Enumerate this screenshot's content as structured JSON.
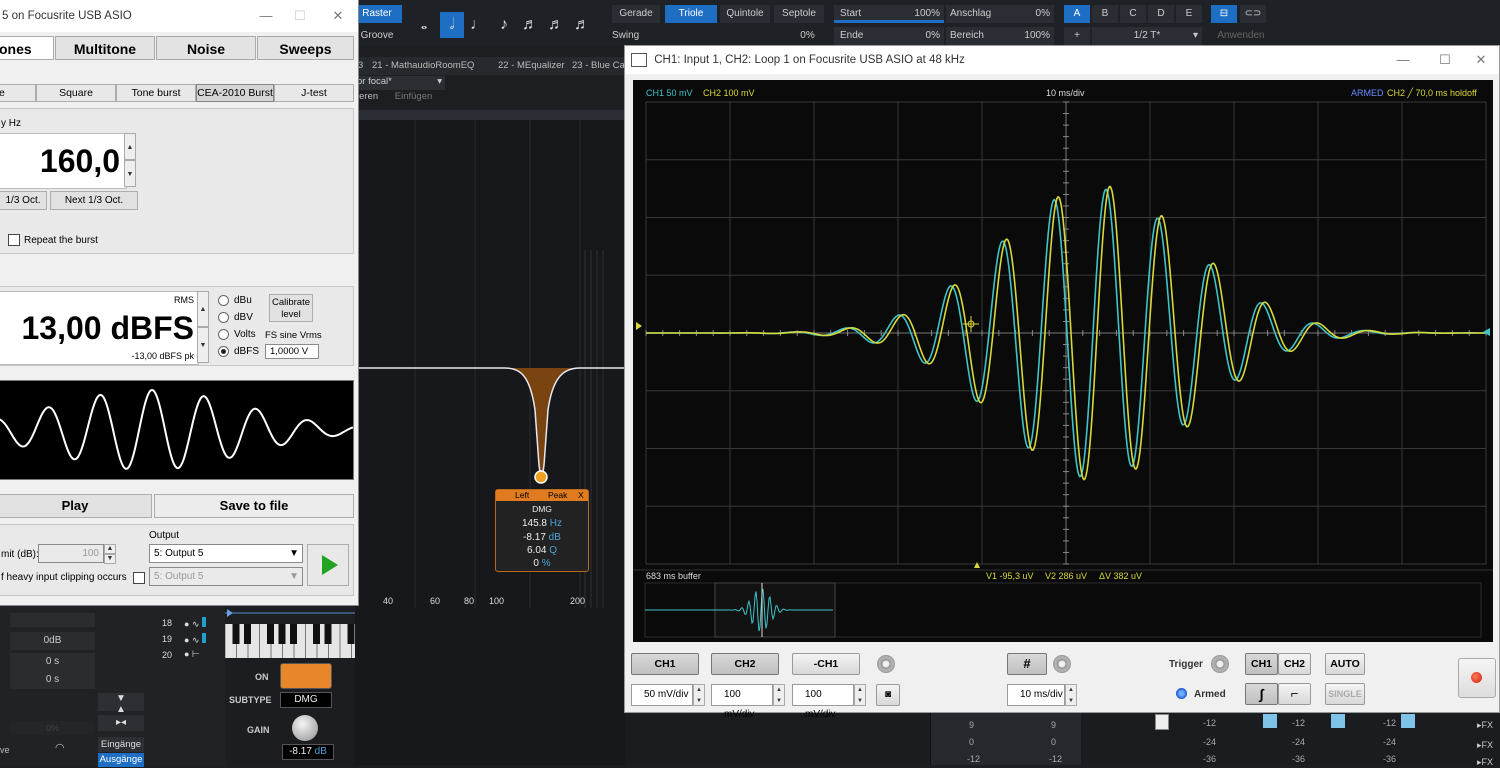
{
  "daw": {
    "raster_label": "Raster",
    "groove_label": "Groove",
    "quant_tabs": [
      "Gerade",
      "Triole",
      "Quintole",
      "Septole"
    ],
    "quant_active": "Triole",
    "swing_label": "Swing",
    "swing_value": "0%",
    "start_label": "Start",
    "start_value": "100%",
    "ende_label": "Ende",
    "ende_value": "0%",
    "anschlag_label": "Anschlag",
    "anschlag_value": "0%",
    "bereich_label": "Bereich",
    "bereich_value": "100%",
    "letters": [
      "A",
      "B",
      "C",
      "D",
      "E"
    ],
    "letter_active": "A",
    "half_label": "1/2 T*",
    "plus_label": "+",
    "anwenden_label": "Anwenden",
    "plugin_tabs": [
      "3",
      "21 - MathaudioRoomEQ",
      "22 - MEqualizer",
      "23 - Blue Ca"
    ],
    "preset_label": "or focal*",
    "menu_items": [
      "ieren",
      "Einfügen"
    ],
    "eq_freq_labels": [
      "40",
      "60",
      "80",
      "100",
      "200"
    ],
    "eq_popup": {
      "head_left": "Left",
      "head_mid": "Peak",
      "head_x": "X",
      "type": "DMG",
      "freq": "145.8",
      "freq_unit": "Hz",
      "gain": "-8.17",
      "gain_unit": "dB",
      "q": "6.04",
      "q_unit": "Q",
      "mix": "0",
      "mix_unit": "%"
    },
    "track_numbers": [
      "18",
      "19",
      "20"
    ],
    "bottom_values": [
      "0dB",
      "0 s",
      "0 s",
      "0%"
    ],
    "eingaenge_label": "Eingänge",
    "ausgaenge_label": "Ausgänge",
    "ve_label": "ve",
    "on_label": "ON",
    "subtype_label": "SUBTYPE",
    "subtype_value": "DMG",
    "gain_label": "GAIN",
    "gain_value": "-8.17",
    "gain_unit": "dB",
    "mixer_values": [
      "9",
      "0",
      "-12",
      "9",
      "0",
      "-12",
      "-12",
      "-24",
      "-36",
      "-12",
      "-24",
      "-36",
      "-12",
      "-24",
      "-36"
    ],
    "fx_label": "FX"
  },
  "generator": {
    "title": "5 on Focusrite USB ASIO",
    "tabs": [
      "ones",
      "Multitone",
      "Noise",
      "Sweeps"
    ],
    "active_tab": "ones",
    "subtabs": [
      "e",
      "Square",
      "Tone burst",
      "CEA-2010 Burst",
      "J-test"
    ],
    "active_subtab": "CEA-2010 Burst",
    "freq_label": "y Hz",
    "freq_value": "160,0",
    "prev_oct": "1/3 Oct.",
    "next_oct": "Next 1/3 Oct.",
    "repeat_label": "Repeat the burst",
    "level_mode": "RMS",
    "level_value": "13,00 dBFS",
    "level_pk": "-13,00 dBFS pk",
    "units": [
      "dBu",
      "dBV",
      "Volts",
      "dBFS"
    ],
    "unit_selected": "dBFS",
    "calibrate_label": "Calibrate level",
    "fs_label": "FS sine Vrms",
    "fs_value": "1,0000 V",
    "play_label": "Play",
    "save_label": "Save to file",
    "output_label": "Output",
    "limit_label": "mit (dB):",
    "limit_value": "100",
    "clip_label": "f heavy input clipping occurs",
    "output_value": "5: Output 5",
    "output2_value": "5: Output 5"
  },
  "scope": {
    "title": "CH1: Input 1, CH2: Loop 1 on Focusrite USB ASIO at 48 kHz",
    "ch1_scale": "CH1 50 mV",
    "ch2_scale": "CH2 100 mV",
    "timebase": "10 ms/div",
    "armed": "ARMED",
    "trigger_info": "CH2",
    "holdoff": "70,0 ms holdoff",
    "buffer": "683 ms buffer",
    "v1": "V1 -95,3 uV",
    "v2": "V2 286 uV",
    "dv": "ΔV 382 uV",
    "buttons": {
      "ch1": "CH1",
      "ch2": "CH2",
      "neg_ch1": "-CH1",
      "ch1_div": "50 mV/div",
      "ch2_div": "100 mV/div",
      "neg_div": "100 mV/div",
      "time_div": "10 ms/div",
      "trigger": "Trigger",
      "armed": "Armed",
      "trig_ch1": "CH1",
      "trig_ch2": "CH2",
      "auto": "AUTO",
      "single": "SINGLE"
    },
    "colors": {
      "ch1": "#3fc3c9",
      "ch2": "#d8d83a",
      "grid": "#3a3a3a",
      "screen": "#0a0a0a"
    }
  }
}
